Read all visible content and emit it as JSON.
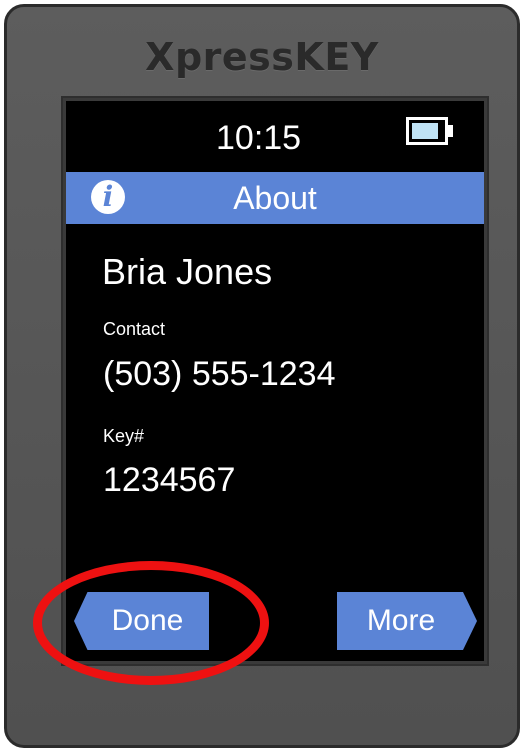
{
  "device": {
    "brand": "XpressKEY"
  },
  "status_bar": {
    "time": "10:15",
    "battery_level": 0.85
  },
  "header": {
    "icon": "info-icon",
    "icon_glyph": "i",
    "title": "About"
  },
  "profile": {
    "name": "Bria Jones",
    "contact_label": "Contact",
    "contact_value": "(503) 555-1234",
    "key_label": "Key#",
    "key_value": "1234567"
  },
  "buttons": {
    "done": "Done",
    "more": "More"
  },
  "colors": {
    "accent": "#5b84d6",
    "screen_bg": "#000000",
    "device_body": "#575757",
    "highlight": "#ee1111"
  }
}
